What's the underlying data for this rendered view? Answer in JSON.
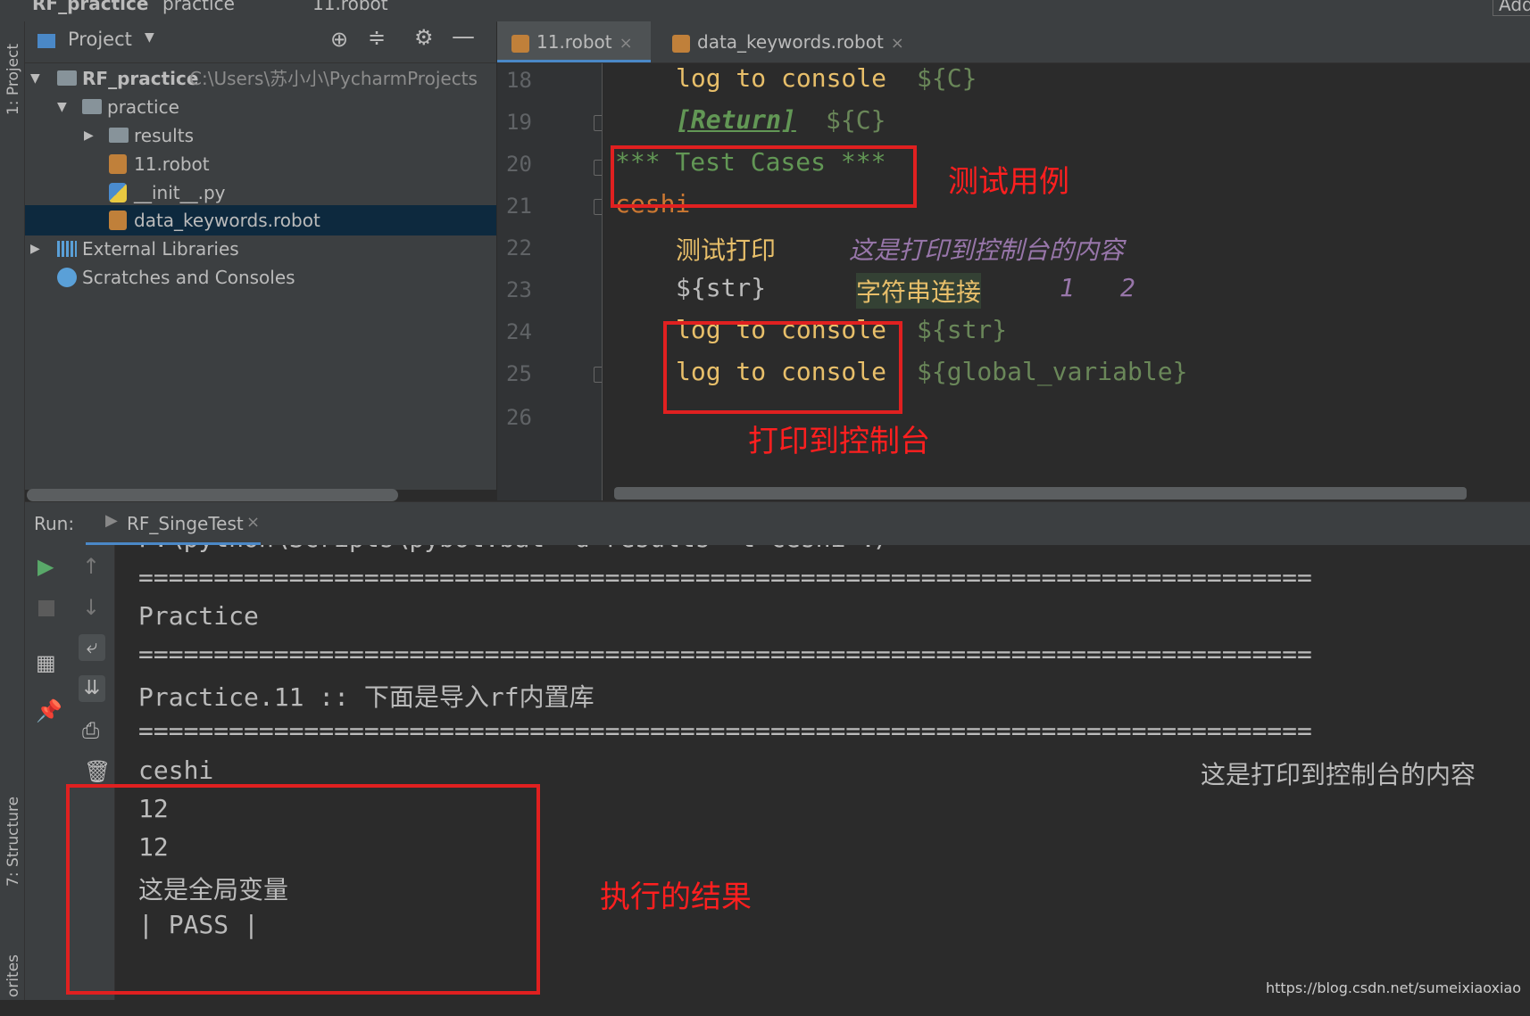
{
  "breadcrumb": {
    "items": [
      "RF_practice",
      "practice",
      "11.robot"
    ],
    "right_label": "Add"
  },
  "sidebar": {
    "project_tab": "1: Project",
    "structure_tab": "7: Structure",
    "favorites_tab": "orites"
  },
  "project_panel": {
    "title": "Project",
    "root_name": "RF_practice",
    "root_path": "C:\\Users\\苏小小\\PycharmProjects",
    "items": [
      {
        "label": "practice"
      },
      {
        "label": "results"
      },
      {
        "label": "11.robot"
      },
      {
        "label": "__init__.py"
      },
      {
        "label": "data_keywords.robot"
      },
      {
        "label": "External Libraries"
      },
      {
        "label": "Scratches and Consoles"
      }
    ]
  },
  "editor": {
    "tabs": [
      {
        "label": "11.robot"
      },
      {
        "label": "data_keywords.robot"
      }
    ],
    "line_numbers": [
      "18",
      "19",
      "20",
      "21",
      "22",
      "23",
      "24",
      "25",
      "26"
    ],
    "lines": {
      "l18_kw": "log to console",
      "l18_arg": "${C}",
      "l19_kw": "[Return]",
      "l19_arg": "${C}",
      "l20": "*** Test Cases ***",
      "l21": "ceshi",
      "l22_kw": "测试打印",
      "l22_arg": "这是打印到控制台的内容",
      "l23_var": "${str}",
      "l23_kw": "字符串连接",
      "l23_a1": "1",
      "l23_a2": "2",
      "l24_kw": "log to console",
      "l24_arg": "${str}",
      "l25_kw": "log to console",
      "l25_arg": "${global_variable}"
    }
  },
  "run_panel": {
    "label": "Run:",
    "config_name": "RF_SingeTest",
    "console_lines": {
      "cmd": "F:\\python\\Scripts\\pybot.bat -d results -t ceshi ./",
      "sep1": "==============================================================================",
      "suite": "Practice",
      "sep2": "==============================================================================",
      "subsuite": "Practice.11 :: 下面是导入rf内置库",
      "sep3": "==============================================================================",
      "test": "ceshi",
      "out1": "12",
      "out2": "12",
      "out3": "这是全局变量",
      "status": "| PASS |",
      "right_msg": "这是打印到控制台的内容"
    }
  },
  "annotations": {
    "test_cases": "测试用例",
    "print_console": "打印到控制台",
    "result": "执行的结果",
    "color": "#e02020"
  },
  "watermark": "https://blog.csdn.net/sumeixiaoxiao"
}
